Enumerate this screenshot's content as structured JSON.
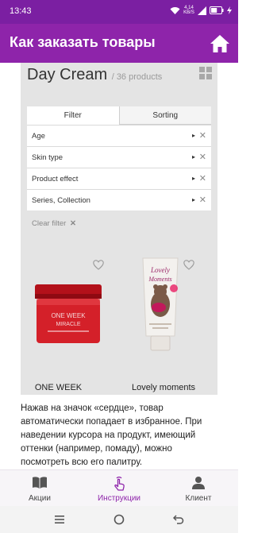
{
  "status_bar": {
    "time": "13:43",
    "speed_value": "4,14",
    "speed_unit": "KB/S",
    "battery_level_percent": 60
  },
  "app_bar": {
    "title": "Как заказать товары",
    "home_icon": "home-icon",
    "background_color": "#8e24aa"
  },
  "screenshot": {
    "title": "Day Cream",
    "count": "/ 36 products",
    "grid_icon": "grid-view-icon",
    "filter_tabs": [
      "Filter",
      "Sorting"
    ],
    "filter_rows": [
      {
        "label": "Age",
        "arrow": "▸",
        "close": "✕"
      },
      {
        "label": "Skin type",
        "arrow": "▸",
        "close": "✕"
      },
      {
        "label": "Product effect",
        "arrow": "▸",
        "close": "✕"
      },
      {
        "label": "Series, Collection",
        "arrow": "▸",
        "close": "✕"
      }
    ],
    "clear_filter": "Clear filter",
    "clear_filter_x": "✕",
    "products": [
      {
        "name": "ONE WEEK",
        "jar_label": "ONE WEEK",
        "jar_sublabel": "MIRACLE"
      },
      {
        "name": "Lovely moments",
        "tube_label_1": "Lovely",
        "tube_label_2": "Moments"
      }
    ]
  },
  "instruction": {
    "text": "Нажав на значок «сердце», товар автоматически попадает в избранное. При наведении курсора на продукт, имеющий оттенки (например, помаду), можно посмотреть всю его палитру."
  },
  "bottom_nav": {
    "items": [
      {
        "label": "Акции",
        "icon": "book-icon"
      },
      {
        "label": "Инструкции",
        "icon": "touch-hand-icon"
      },
      {
        "label": "Клиент",
        "icon": "person-icon"
      }
    ],
    "active_index": 1,
    "active_color": "#8e24aa"
  },
  "system_nav": {
    "menu_icon": "menu-icon",
    "home_icon": "circle-home-icon",
    "back_icon": "back-icon"
  }
}
